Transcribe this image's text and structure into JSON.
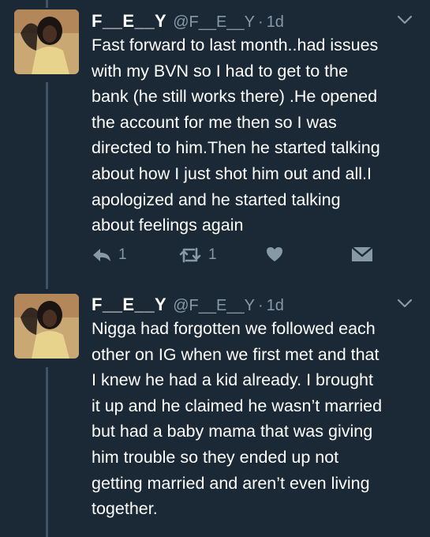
{
  "colors": {
    "background": "#1b2836",
    "text": "#ffffff",
    "secondary": "#8899a6",
    "thread_line": "#3d5466",
    "avatar_bg": "#c9a874"
  },
  "tweets": [
    {
      "display_name": "F__E__Y",
      "handle": "@F__E__Y",
      "separator": "·",
      "time": "1d",
      "lines": [
        "Fast forward to last month..had issues",
        "with my BVN so I had to get to the",
        "bank (he still works there) .He opened",
        "the account for me then so I was",
        "directed to him.Then he started talking",
        "about how I just shot him out and all.I",
        "apologized and he started talking",
        "about feelings again"
      ],
      "reply_count": "1",
      "retweet_count": "1"
    },
    {
      "display_name": "F__E__Y",
      "handle": "@F__E__Y",
      "separator": "·",
      "time": "1d",
      "lines": [
        "Nigga had forgotten we followed each",
        "other on IG when we first met and that",
        "I knew he had a kid already. I brought",
        "it up and he claimed he wasn’t married",
        "but had a baby mama that was giving",
        "him trouble so they ended up not",
        "getting married and aren’t even living",
        "together."
      ]
    }
  ]
}
